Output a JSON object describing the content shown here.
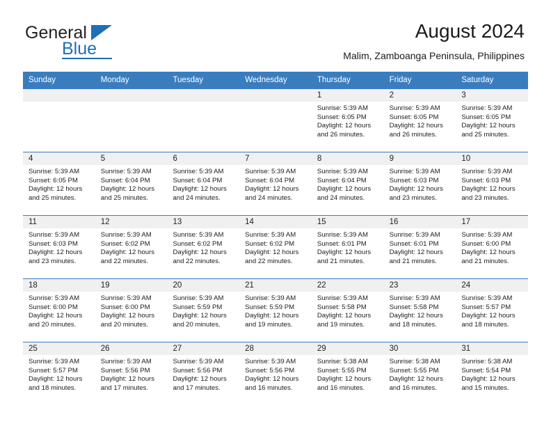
{
  "logo": {
    "word_one": "General",
    "word_two": "Blue",
    "accent_color": "#1f6fb5",
    "triangle_icon": "triangle-icon"
  },
  "header": {
    "title": "August 2024",
    "subtitle": "Malim, Zamboanga Peninsula, Philippines"
  },
  "calendar": {
    "header_bg": "#3a7dbf",
    "day_bar_bg": "#f0f0f0",
    "weekdays": [
      "Sunday",
      "Monday",
      "Tuesday",
      "Wednesday",
      "Thursday",
      "Friday",
      "Saturday"
    ],
    "weeks": [
      [
        {
          "day": "",
          "empty": true,
          "sunrise": "",
          "sunset": "",
          "daylight_line1": "",
          "daylight_line2": ""
        },
        {
          "day": "",
          "empty": true,
          "sunrise": "",
          "sunset": "",
          "daylight_line1": "",
          "daylight_line2": ""
        },
        {
          "day": "",
          "empty": true,
          "sunrise": "",
          "sunset": "",
          "daylight_line1": "",
          "daylight_line2": ""
        },
        {
          "day": "",
          "empty": true,
          "sunrise": "",
          "sunset": "",
          "daylight_line1": "",
          "daylight_line2": ""
        },
        {
          "day": "1",
          "empty": false,
          "sunrise": "Sunrise: 5:39 AM",
          "sunset": "Sunset: 6:05 PM",
          "daylight_line1": "Daylight: 12 hours",
          "daylight_line2": "and 26 minutes."
        },
        {
          "day": "2",
          "empty": false,
          "sunrise": "Sunrise: 5:39 AM",
          "sunset": "Sunset: 6:05 PM",
          "daylight_line1": "Daylight: 12 hours",
          "daylight_line2": "and 26 minutes."
        },
        {
          "day": "3",
          "empty": false,
          "sunrise": "Sunrise: 5:39 AM",
          "sunset": "Sunset: 6:05 PM",
          "daylight_line1": "Daylight: 12 hours",
          "daylight_line2": "and 25 minutes."
        }
      ],
      [
        {
          "day": "4",
          "empty": false,
          "sunrise": "Sunrise: 5:39 AM",
          "sunset": "Sunset: 6:05 PM",
          "daylight_line1": "Daylight: 12 hours",
          "daylight_line2": "and 25 minutes."
        },
        {
          "day": "5",
          "empty": false,
          "sunrise": "Sunrise: 5:39 AM",
          "sunset": "Sunset: 6:04 PM",
          "daylight_line1": "Daylight: 12 hours",
          "daylight_line2": "and 25 minutes."
        },
        {
          "day": "6",
          "empty": false,
          "sunrise": "Sunrise: 5:39 AM",
          "sunset": "Sunset: 6:04 PM",
          "daylight_line1": "Daylight: 12 hours",
          "daylight_line2": "and 24 minutes."
        },
        {
          "day": "7",
          "empty": false,
          "sunrise": "Sunrise: 5:39 AM",
          "sunset": "Sunset: 6:04 PM",
          "daylight_line1": "Daylight: 12 hours",
          "daylight_line2": "and 24 minutes."
        },
        {
          "day": "8",
          "empty": false,
          "sunrise": "Sunrise: 5:39 AM",
          "sunset": "Sunset: 6:04 PM",
          "daylight_line1": "Daylight: 12 hours",
          "daylight_line2": "and 24 minutes."
        },
        {
          "day": "9",
          "empty": false,
          "sunrise": "Sunrise: 5:39 AM",
          "sunset": "Sunset: 6:03 PM",
          "daylight_line1": "Daylight: 12 hours",
          "daylight_line2": "and 23 minutes."
        },
        {
          "day": "10",
          "empty": false,
          "sunrise": "Sunrise: 5:39 AM",
          "sunset": "Sunset: 6:03 PM",
          "daylight_line1": "Daylight: 12 hours",
          "daylight_line2": "and 23 minutes."
        }
      ],
      [
        {
          "day": "11",
          "empty": false,
          "sunrise": "Sunrise: 5:39 AM",
          "sunset": "Sunset: 6:03 PM",
          "daylight_line1": "Daylight: 12 hours",
          "daylight_line2": "and 23 minutes."
        },
        {
          "day": "12",
          "empty": false,
          "sunrise": "Sunrise: 5:39 AM",
          "sunset": "Sunset: 6:02 PM",
          "daylight_line1": "Daylight: 12 hours",
          "daylight_line2": "and 22 minutes."
        },
        {
          "day": "13",
          "empty": false,
          "sunrise": "Sunrise: 5:39 AM",
          "sunset": "Sunset: 6:02 PM",
          "daylight_line1": "Daylight: 12 hours",
          "daylight_line2": "and 22 minutes."
        },
        {
          "day": "14",
          "empty": false,
          "sunrise": "Sunrise: 5:39 AM",
          "sunset": "Sunset: 6:02 PM",
          "daylight_line1": "Daylight: 12 hours",
          "daylight_line2": "and 22 minutes."
        },
        {
          "day": "15",
          "empty": false,
          "sunrise": "Sunrise: 5:39 AM",
          "sunset": "Sunset: 6:01 PM",
          "daylight_line1": "Daylight: 12 hours",
          "daylight_line2": "and 21 minutes."
        },
        {
          "day": "16",
          "empty": false,
          "sunrise": "Sunrise: 5:39 AM",
          "sunset": "Sunset: 6:01 PM",
          "daylight_line1": "Daylight: 12 hours",
          "daylight_line2": "and 21 minutes."
        },
        {
          "day": "17",
          "empty": false,
          "sunrise": "Sunrise: 5:39 AM",
          "sunset": "Sunset: 6:00 PM",
          "daylight_line1": "Daylight: 12 hours",
          "daylight_line2": "and 21 minutes."
        }
      ],
      [
        {
          "day": "18",
          "empty": false,
          "sunrise": "Sunrise: 5:39 AM",
          "sunset": "Sunset: 6:00 PM",
          "daylight_line1": "Daylight: 12 hours",
          "daylight_line2": "and 20 minutes."
        },
        {
          "day": "19",
          "empty": false,
          "sunrise": "Sunrise: 5:39 AM",
          "sunset": "Sunset: 6:00 PM",
          "daylight_line1": "Daylight: 12 hours",
          "daylight_line2": "and 20 minutes."
        },
        {
          "day": "20",
          "empty": false,
          "sunrise": "Sunrise: 5:39 AM",
          "sunset": "Sunset: 5:59 PM",
          "daylight_line1": "Daylight: 12 hours",
          "daylight_line2": "and 20 minutes."
        },
        {
          "day": "21",
          "empty": false,
          "sunrise": "Sunrise: 5:39 AM",
          "sunset": "Sunset: 5:59 PM",
          "daylight_line1": "Daylight: 12 hours",
          "daylight_line2": "and 19 minutes."
        },
        {
          "day": "22",
          "empty": false,
          "sunrise": "Sunrise: 5:39 AM",
          "sunset": "Sunset: 5:58 PM",
          "daylight_line1": "Daylight: 12 hours",
          "daylight_line2": "and 19 minutes."
        },
        {
          "day": "23",
          "empty": false,
          "sunrise": "Sunrise: 5:39 AM",
          "sunset": "Sunset: 5:58 PM",
          "daylight_line1": "Daylight: 12 hours",
          "daylight_line2": "and 18 minutes."
        },
        {
          "day": "24",
          "empty": false,
          "sunrise": "Sunrise: 5:39 AM",
          "sunset": "Sunset: 5:57 PM",
          "daylight_line1": "Daylight: 12 hours",
          "daylight_line2": "and 18 minutes."
        }
      ],
      [
        {
          "day": "25",
          "empty": false,
          "sunrise": "Sunrise: 5:39 AM",
          "sunset": "Sunset: 5:57 PM",
          "daylight_line1": "Daylight: 12 hours",
          "daylight_line2": "and 18 minutes."
        },
        {
          "day": "26",
          "empty": false,
          "sunrise": "Sunrise: 5:39 AM",
          "sunset": "Sunset: 5:56 PM",
          "daylight_line1": "Daylight: 12 hours",
          "daylight_line2": "and 17 minutes."
        },
        {
          "day": "27",
          "empty": false,
          "sunrise": "Sunrise: 5:39 AM",
          "sunset": "Sunset: 5:56 PM",
          "daylight_line1": "Daylight: 12 hours",
          "daylight_line2": "and 17 minutes."
        },
        {
          "day": "28",
          "empty": false,
          "sunrise": "Sunrise: 5:39 AM",
          "sunset": "Sunset: 5:56 PM",
          "daylight_line1": "Daylight: 12 hours",
          "daylight_line2": "and 16 minutes."
        },
        {
          "day": "29",
          "empty": false,
          "sunrise": "Sunrise: 5:38 AM",
          "sunset": "Sunset: 5:55 PM",
          "daylight_line1": "Daylight: 12 hours",
          "daylight_line2": "and 16 minutes."
        },
        {
          "day": "30",
          "empty": false,
          "sunrise": "Sunrise: 5:38 AM",
          "sunset": "Sunset: 5:55 PM",
          "daylight_line1": "Daylight: 12 hours",
          "daylight_line2": "and 16 minutes."
        },
        {
          "day": "31",
          "empty": false,
          "sunrise": "Sunrise: 5:38 AM",
          "sunset": "Sunset: 5:54 PM",
          "daylight_line1": "Daylight: 12 hours",
          "daylight_line2": "and 15 minutes."
        }
      ]
    ]
  }
}
